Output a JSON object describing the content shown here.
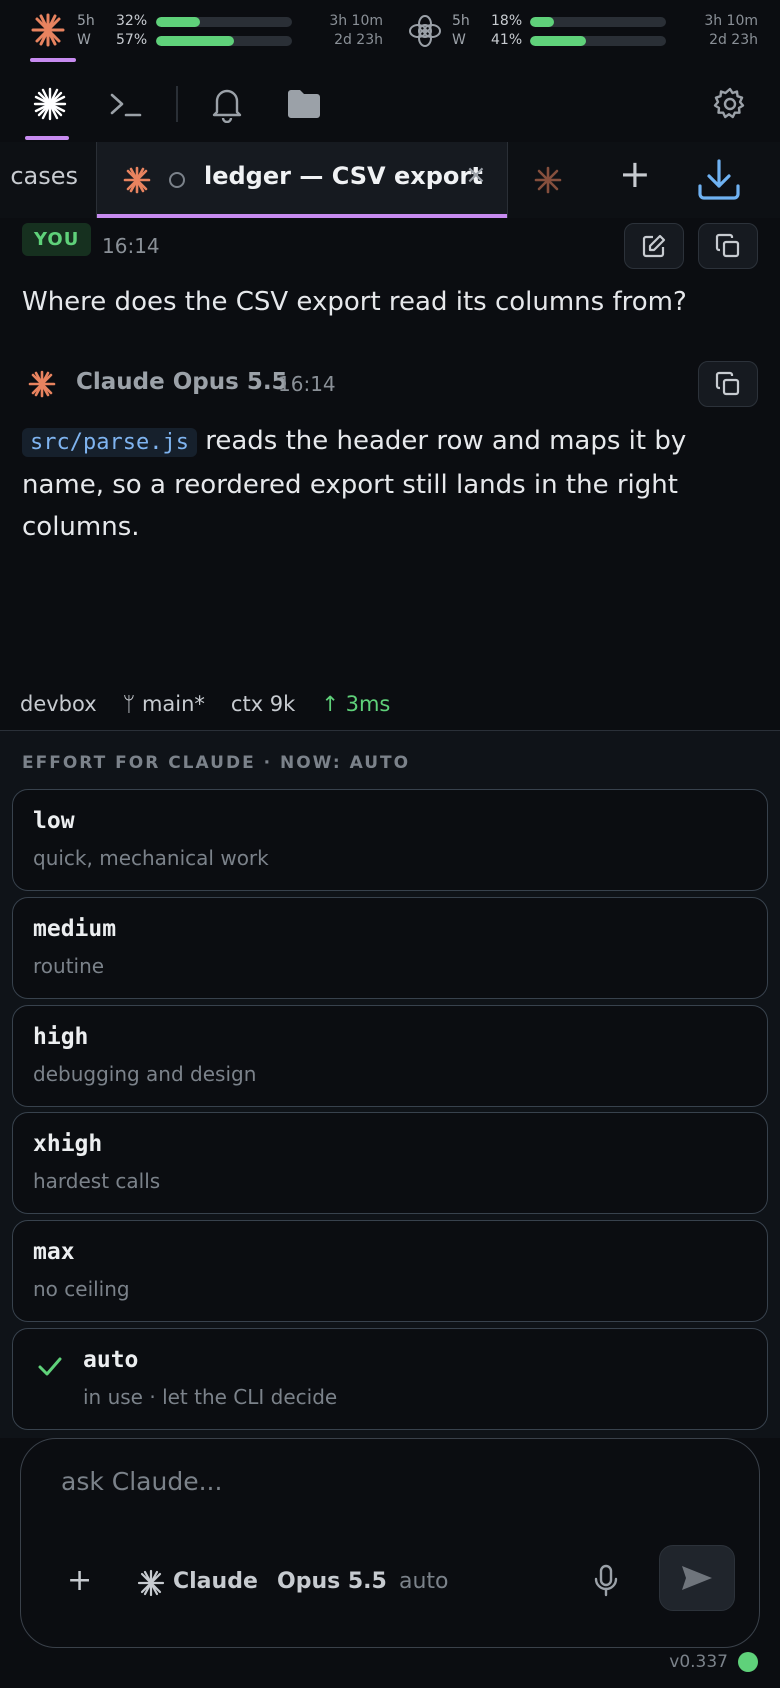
{
  "usage": {
    "claude": {
      "icon": "claude-starburst-icon",
      "rows": [
        {
          "label": "5h",
          "pct": "32%",
          "fill": 0.32,
          "time": "3h 10m"
        },
        {
          "label": "W",
          "pct": "57%",
          "fill": 0.57,
          "time": "2d 23h"
        }
      ]
    },
    "openai": {
      "icon": "openai-knot-icon",
      "rows": [
        {
          "label": "5h",
          "pct": "18%",
          "fill": 0.18,
          "time": "3h 10m"
        },
        {
          "label": "W",
          "pct": "41%",
          "fill": 0.41,
          "time": "2d 23h"
        }
      ]
    }
  },
  "tabs": {
    "left_partial": "cases",
    "active_title": "ledger — CSV export",
    "close": "×",
    "new_tab": "+"
  },
  "conversation": {
    "user": {
      "badge": "YOU",
      "time": "16:14",
      "text": "Where does the CSV export read its columns from?"
    },
    "assistant": {
      "name": "Claude Opus 5.5",
      "time": "16:14",
      "code": "src/parse.js",
      "text": " reads the header row and maps it by name, so a reordered export still lands in the right columns."
    }
  },
  "status": {
    "host": "devbox",
    "branch": "main*",
    "branch_glyph": "ᛘ",
    "ctx": "ctx 9k",
    "latency": "↑ 3ms"
  },
  "effort": {
    "title": "EFFORT FOR CLAUDE · NOW: AUTO",
    "options": [
      {
        "name": "low",
        "desc": "quick, mechanical work",
        "selected": false
      },
      {
        "name": "medium",
        "desc": "routine",
        "selected": false
      },
      {
        "name": "high",
        "desc": "debugging and design",
        "selected": false
      },
      {
        "name": "xhigh",
        "desc": "hardest calls",
        "selected": false
      },
      {
        "name": "max",
        "desc": "no ceiling",
        "selected": false
      },
      {
        "name": "auto",
        "desc": "in use · let the CLI decide",
        "selected": true
      }
    ]
  },
  "composer": {
    "placeholder": "ask Claude...",
    "add": "+",
    "agent": "Claude",
    "model": "Opus 5.5",
    "effort": "auto"
  },
  "footer": {
    "version": "v0.337"
  },
  "colors": {
    "accent_green": "#5fd17a",
    "accent_purple": "#c78bf0",
    "claude_orange": "#e8835f",
    "link_blue": "#6fb2f2"
  }
}
